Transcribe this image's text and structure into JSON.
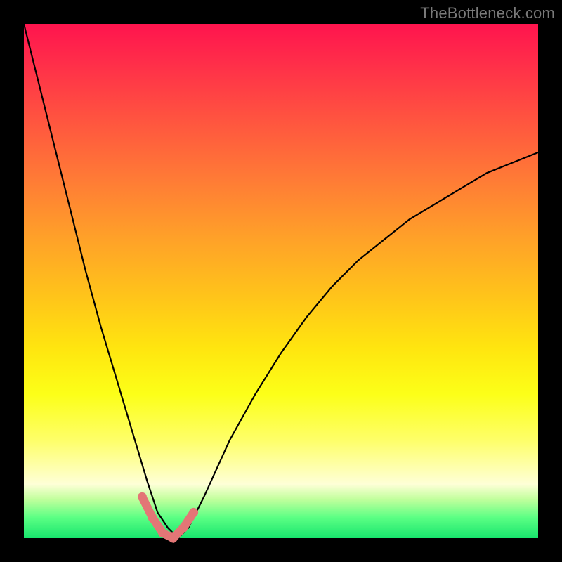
{
  "watermark": "TheBottleneck.com",
  "colors": {
    "frame": "#000000",
    "curve": "#000000",
    "markers": "#e37676",
    "gradient_stops": [
      "#ff144e",
      "#ff2f49",
      "#ff5240",
      "#ff7a36",
      "#ffa228",
      "#ffc41a",
      "#ffe50f",
      "#fcff18",
      "#feff69",
      "#feffd7",
      "#c0ff9c",
      "#5bff84",
      "#18e56d"
    ]
  },
  "chart_data": {
    "type": "line",
    "title": "",
    "xlabel": "",
    "ylabel": "",
    "xlim": [
      0,
      100
    ],
    "ylim": [
      0,
      100
    ],
    "legend": false,
    "grid": false,
    "note": "V-shaped bottleneck curve: value ≈ 100 at x=0, drops steeply to 0 near x≈25–30, then rises with decreasing slope toward ≈75 at x=100. Pink markers sit on the curve near the minimum.",
    "series": [
      {
        "name": "bottleneck_curve",
        "x": [
          0,
          3,
          6,
          9,
          12,
          15,
          18,
          21,
          24,
          26,
          28,
          30,
          32,
          35,
          40,
          45,
          50,
          55,
          60,
          65,
          70,
          75,
          80,
          85,
          90,
          95,
          100
        ],
        "values": [
          100,
          88,
          76,
          64,
          52,
          41,
          31,
          21,
          11,
          5,
          2,
          0,
          2,
          8,
          19,
          28,
          36,
          43,
          49,
          54,
          58,
          62,
          65,
          68,
          71,
          73,
          75
        ]
      }
    ],
    "markers": {
      "name": "highlighted_points",
      "x": [
        23,
        25,
        27,
        29,
        31,
        33
      ],
      "values": [
        8,
        4,
        1,
        0,
        2,
        5
      ]
    }
  }
}
